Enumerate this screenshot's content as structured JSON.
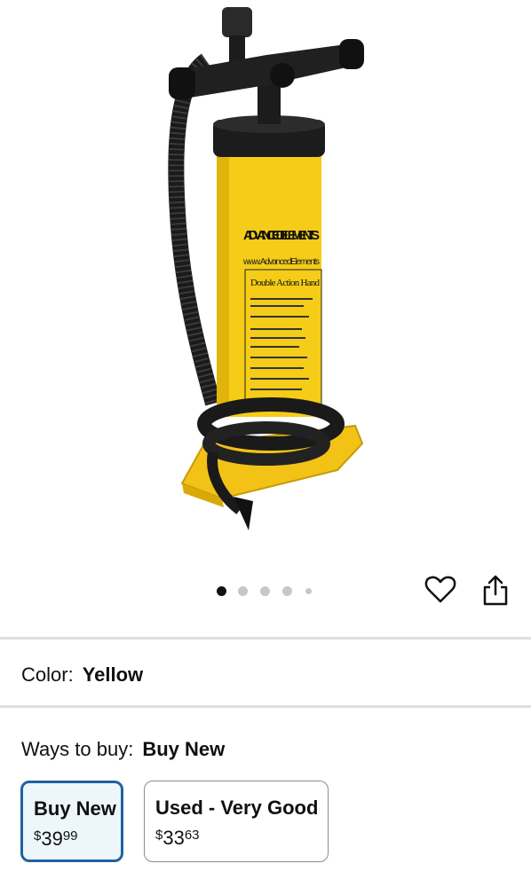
{
  "product": {
    "image_name": "double-action-hand-pump",
    "brand_print": "ADVANCED ELEMENTS",
    "site_print": "www.AdvancedElements",
    "title_print": "Double Action Hand"
  },
  "carousel": {
    "count": 5,
    "active_index": 0
  },
  "color": {
    "label": "Color:",
    "value": "Yellow"
  },
  "ways_to_buy": {
    "label": "Ways to buy:",
    "value": "Buy New"
  },
  "options": [
    {
      "label": "Buy New",
      "currency": "$",
      "whole": "39",
      "cents": "99"
    },
    {
      "label": "Used - Very Good",
      "currency": "$",
      "whole": "33",
      "cents": "63"
    }
  ],
  "colors": {
    "selected_border": "#2162a1",
    "selected_bg": "#edf6fb",
    "pump_yellow": "#f5cc17"
  }
}
